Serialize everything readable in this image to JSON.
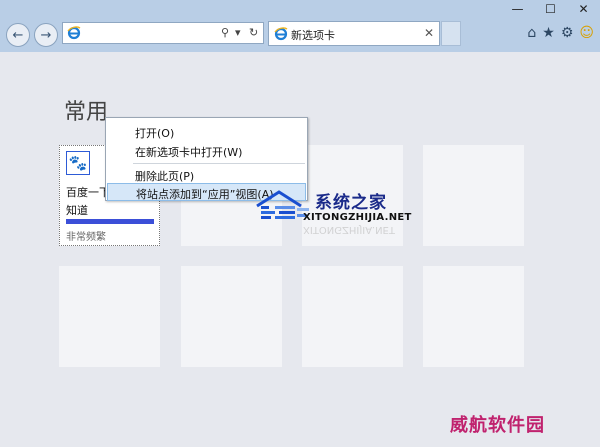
{
  "browser": {
    "address_value": "",
    "tab_label": "新选项卡"
  },
  "content": {
    "section_title": "常用",
    "pinned_tile": {
      "name_line1": "百度一下",
      "name_line2": "知道",
      "subtitle": "非常频繁"
    }
  },
  "context_menu": {
    "items": [
      {
        "label": "打开(O)"
      },
      {
        "label": "在新选项卡中打开(W)"
      },
      {
        "label": "删除此页(P)"
      },
      {
        "label": "将站点添加到“应用”视图(A)"
      }
    ]
  },
  "watermarks": {
    "site_name": "系统之家",
    "site_url": "XITONGZHIJIA.NET",
    "corner_text": "威航软件园"
  },
  "icons": [
    "back-arrow-icon",
    "forward-arrow-icon",
    "ie-logo-icon",
    "search-icon",
    "refresh-icon",
    "close-icon",
    "home-icon",
    "favorites-star-icon",
    "gear-icon",
    "smiley-icon",
    "paw-icon"
  ],
  "colors": {
    "menu_highlight": "#d6e7f8",
    "tile_accent": "#3b4fd8",
    "watermark_pink": "#c0226e"
  }
}
